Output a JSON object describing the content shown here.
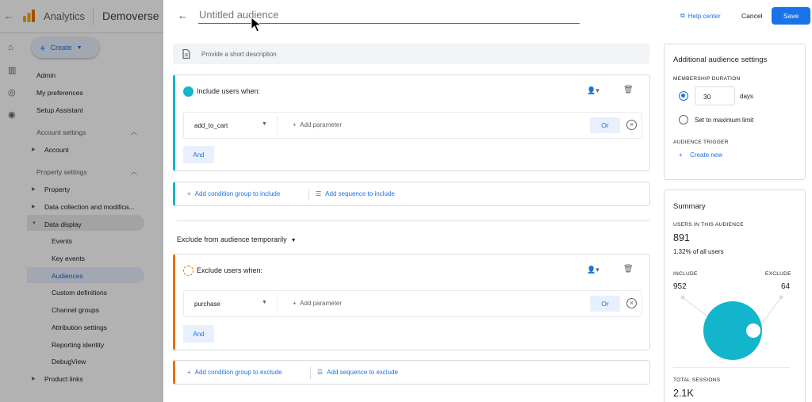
{
  "background": {
    "app_name": "Analytics",
    "property_name": "Demoverse",
    "create_label": "Create",
    "nav": {
      "admin": "Admin",
      "my_preferences": "My preferences",
      "setup_assistant": "Setup Assistant",
      "account_settings": "Account settings",
      "account": "Account",
      "property_settings": "Property settings",
      "property": "Property",
      "data_collection": "Data collection and modifica...",
      "data_display": "Data display",
      "events": "Events",
      "key_events": "Key events",
      "audiences": "Audiences",
      "custom_definitions": "Custom definitions",
      "channel_groups": "Channel groups",
      "attribution_settings": "Attribution settings",
      "reporting_identity": "Reporting identity",
      "debugview": "DebugView",
      "product_links": "Product links"
    }
  },
  "header": {
    "title_placeholder": "Untitled audience",
    "help_center": "Help center",
    "cancel": "Cancel",
    "save": "Save"
  },
  "description_placeholder": "Provide a short description",
  "include": {
    "title": "Include users when:",
    "event": "add_to_cart",
    "add_parameter": "Add parameter",
    "or_label": "Or",
    "and_label": "And",
    "add_condition_group": "Add condition group to include",
    "add_sequence": "Add sequence to include"
  },
  "exclude_header": "Exclude from audience temporarily",
  "exclude": {
    "title": "Exclude users when:",
    "event": "purchase",
    "add_parameter": "Add parameter",
    "or_label": "Or",
    "and_label": "And",
    "add_condition_group": "Add condition group to exclude",
    "add_sequence": "Add sequence to exclude"
  },
  "settings": {
    "title": "Additional audience settings",
    "membership_duration_label": "MEMBERSHIP DURATION",
    "days_value": "30",
    "days_unit": "days",
    "max_limit": "Set to maximum limit",
    "trigger_label": "AUDIENCE TRIGGER",
    "create_new": "Create new"
  },
  "summary": {
    "title": "Summary",
    "users_label": "USERS IN THIS AUDIENCE",
    "users_value": "891",
    "users_pct": "1.32% of all users",
    "include_label": "INCLUDE",
    "include_value": "952",
    "exclude_label": "EXCLUDE",
    "exclude_value": "64",
    "sessions_label": "TOTAL SESSIONS",
    "sessions_value": "2.1K"
  },
  "colors": {
    "accent": "#1a73e8",
    "include": "#12b5cb",
    "exclude": "#e8710a"
  }
}
